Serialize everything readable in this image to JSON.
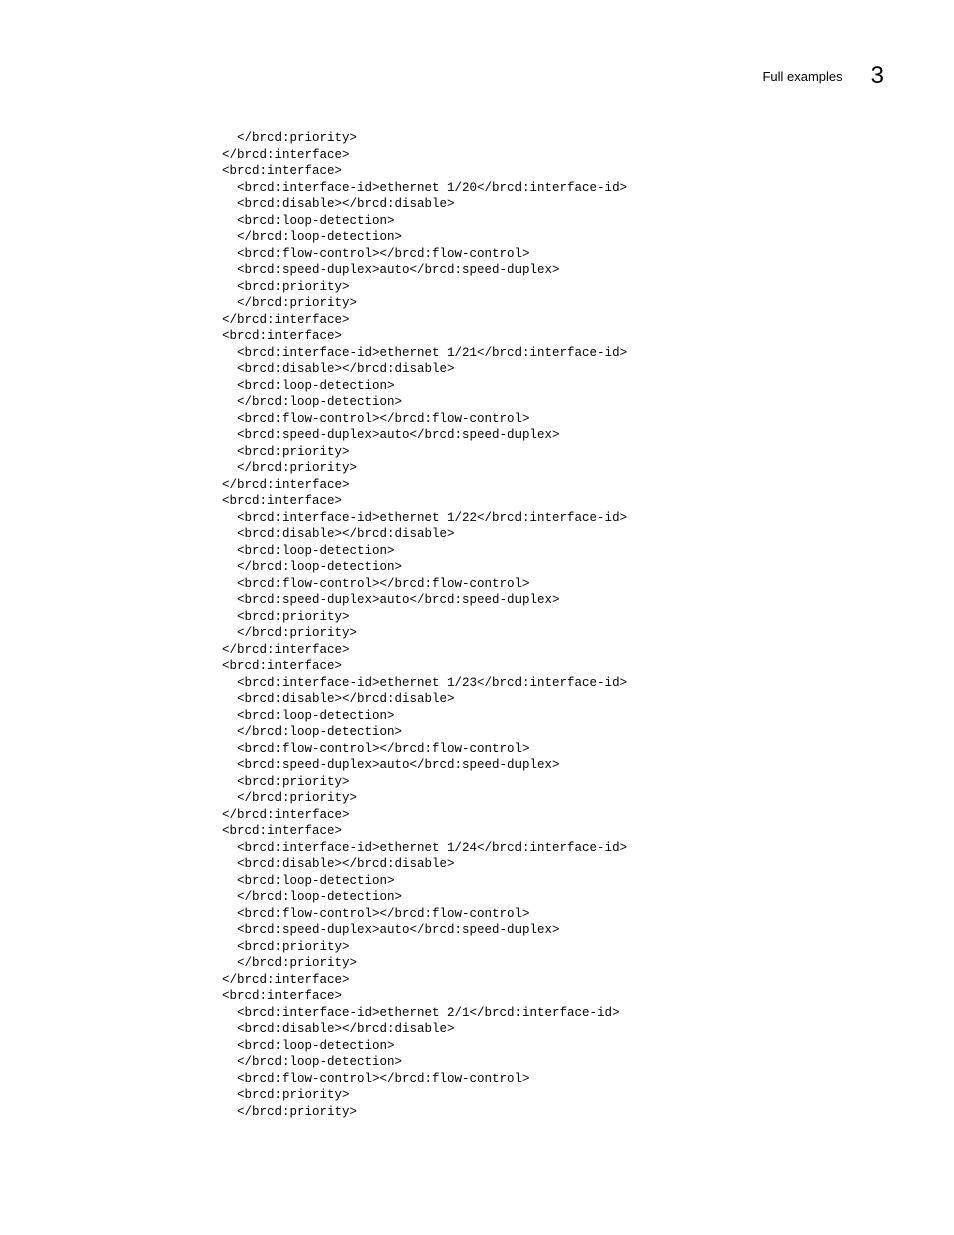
{
  "header": {
    "title": "Full examples",
    "number": "3"
  },
  "code": "  </brcd:priority>\n</brcd:interface>\n<brcd:interface>\n  <brcd:interface-id>ethernet 1/20</brcd:interface-id>\n  <brcd:disable></brcd:disable>\n  <brcd:loop-detection>\n  </brcd:loop-detection>\n  <brcd:flow-control></brcd:flow-control>\n  <brcd:speed-duplex>auto</brcd:speed-duplex>\n  <brcd:priority>\n  </brcd:priority>\n</brcd:interface>\n<brcd:interface>\n  <brcd:interface-id>ethernet 1/21</brcd:interface-id>\n  <brcd:disable></brcd:disable>\n  <brcd:loop-detection>\n  </brcd:loop-detection>\n  <brcd:flow-control></brcd:flow-control>\n  <brcd:speed-duplex>auto</brcd:speed-duplex>\n  <brcd:priority>\n  </brcd:priority>\n</brcd:interface>\n<brcd:interface>\n  <brcd:interface-id>ethernet 1/22</brcd:interface-id>\n  <brcd:disable></brcd:disable>\n  <brcd:loop-detection>\n  </brcd:loop-detection>\n  <brcd:flow-control></brcd:flow-control>\n  <brcd:speed-duplex>auto</brcd:speed-duplex>\n  <brcd:priority>\n  </brcd:priority>\n</brcd:interface>\n<brcd:interface>\n  <brcd:interface-id>ethernet 1/23</brcd:interface-id>\n  <brcd:disable></brcd:disable>\n  <brcd:loop-detection>\n  </brcd:loop-detection>\n  <brcd:flow-control></brcd:flow-control>\n  <brcd:speed-duplex>auto</brcd:speed-duplex>\n  <brcd:priority>\n  </brcd:priority>\n</brcd:interface>\n<brcd:interface>\n  <brcd:interface-id>ethernet 1/24</brcd:interface-id>\n  <brcd:disable></brcd:disable>\n  <brcd:loop-detection>\n  </brcd:loop-detection>\n  <brcd:flow-control></brcd:flow-control>\n  <brcd:speed-duplex>auto</brcd:speed-duplex>\n  <brcd:priority>\n  </brcd:priority>\n</brcd:interface>\n<brcd:interface>\n  <brcd:interface-id>ethernet 2/1</brcd:interface-id>\n  <brcd:disable></brcd:disable>\n  <brcd:loop-detection>\n  </brcd:loop-detection>\n  <brcd:flow-control></brcd:flow-control>\n  <brcd:priority>\n  </brcd:priority>"
}
